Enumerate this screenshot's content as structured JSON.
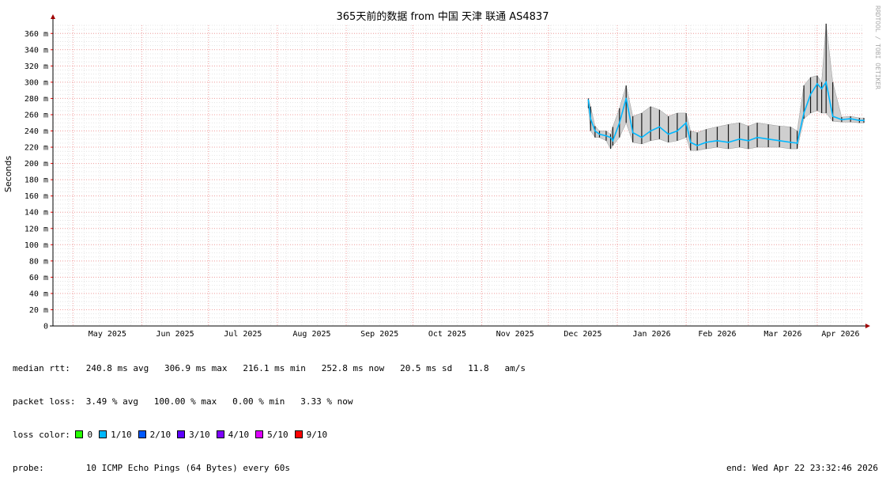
{
  "chart_data": {
    "type": "line",
    "title": "365天前的数据 from 中国 天津 联通 AS4837",
    "ylabel": "Seconds",
    "credit": "RRDTOOL / TOBI OETIKER",
    "y_ticks": [
      "0",
      "20 m",
      "40 m",
      "60 m",
      "80 m",
      "100 m",
      "120 m",
      "140 m",
      "160 m",
      "180 m",
      "200 m",
      "220 m",
      "240 m",
      "260 m",
      "280 m",
      "300 m",
      "320 m",
      "340 m",
      "360 m"
    ],
    "ylim": [
      0,
      0.37
    ],
    "x_ticks": [
      "May 2025",
      "Jun 2025",
      "Jul 2025",
      "Aug 2025",
      "Sep 2025",
      "Oct 2025",
      "Nov 2025",
      "Dec 2025",
      "Jan 2026",
      "Feb 2026",
      "Mar 2026",
      "Apr 2026"
    ],
    "xlim": [
      "2025-04-22",
      "2026-04-22"
    ],
    "grid": true,
    "series": [
      {
        "x": [
          "2025-12-19",
          "2025-12-20",
          "2025-12-22",
          "2025-12-24",
          "2025-12-27",
          "2025-12-29",
          "2025-12-30",
          "2026-01-02",
          "2026-01-05",
          "2026-01-08",
          "2026-01-12",
          "2026-01-16",
          "2026-01-20",
          "2026-01-24",
          "2026-01-28",
          "2026-02-01",
          "2026-02-03",
          "2026-02-06",
          "2026-02-10",
          "2026-02-15",
          "2026-02-20",
          "2026-02-25",
          "2026-03-01",
          "2026-03-05",
          "2026-03-10",
          "2026-03-15",
          "2026-03-20",
          "2026-03-23",
          "2026-03-26",
          "2026-03-29",
          "2026-04-01",
          "2026-04-03",
          "2026-04-05",
          "2026-04-08",
          "2026-04-12",
          "2026-04-16",
          "2026-04-20",
          "2026-04-22"
        ],
        "values": [
          0.278,
          0.255,
          0.24,
          0.236,
          0.234,
          0.232,
          0.228,
          0.25,
          0.28,
          0.238,
          0.232,
          0.24,
          0.245,
          0.236,
          0.24,
          0.25,
          0.226,
          0.222,
          0.226,
          0.228,
          0.226,
          0.23,
          0.228,
          0.232,
          0.23,
          0.228,
          0.226,
          0.225,
          0.262,
          0.285,
          0.298,
          0.292,
          0.3,
          0.258,
          0.254,
          0.255,
          0.253,
          0.253
        ],
        "min": [
          0.268,
          0.24,
          0.232,
          0.232,
          0.228,
          0.218,
          0.222,
          0.232,
          0.25,
          0.226,
          0.224,
          0.228,
          0.23,
          0.226,
          0.228,
          0.232,
          0.216,
          0.216,
          0.218,
          0.22,
          0.218,
          0.22,
          0.218,
          0.22,
          0.22,
          0.22,
          0.218,
          0.218,
          0.255,
          0.262,
          0.265,
          0.262,
          0.262,
          0.252,
          0.251,
          0.251,
          0.25,
          0.25
        ],
        "max": [
          0.28,
          0.27,
          0.246,
          0.24,
          0.24,
          0.236,
          0.245,
          0.268,
          0.296,
          0.258,
          0.262,
          0.27,
          0.266,
          0.258,
          0.262,
          0.262,
          0.24,
          0.238,
          0.242,
          0.245,
          0.248,
          0.25,
          0.246,
          0.25,
          0.248,
          0.246,
          0.245,
          0.24,
          0.296,
          0.306,
          0.308,
          0.3,
          0.372,
          0.3,
          0.257,
          0.258,
          0.256,
          0.256
        ]
      }
    ]
  },
  "legend": {
    "median_rtt": "median rtt:   240.8 ms avg   306.9 ms max   216.1 ms min   252.8 ms now   20.5 ms sd   11.8   am/s",
    "packet_loss": "packet loss:  3.49 % avg   100.00 % max   0.00 % min   3.33 % now",
    "loss_color_label": "loss color: ",
    "loss_colors": [
      {
        "label": "0",
        "color": "#26ff00"
      },
      {
        "label": "1/10",
        "color": "#00b8ff"
      },
      {
        "label": "2/10",
        "color": "#0059ff"
      },
      {
        "label": "3/10",
        "color": "#5e00ff"
      },
      {
        "label": "4/10",
        "color": "#7e00ff"
      },
      {
        "label": "5/10",
        "color": "#dd00ff"
      },
      {
        "label": "9/10",
        "color": "#ff0000"
      }
    ],
    "probe": "probe:        10 ICMP Echo Pings (64 Bytes) every 60s",
    "end": "end: Wed Apr 22 23:32:46 2026"
  }
}
